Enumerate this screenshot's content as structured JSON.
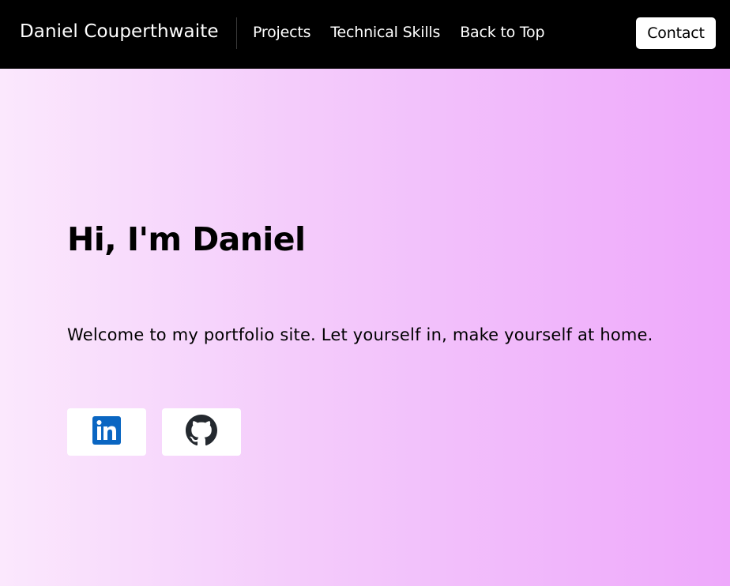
{
  "navbar": {
    "brand": "Daniel Couperthwaite",
    "links": [
      {
        "label": "Projects"
      },
      {
        "label": "Technical Skills"
      },
      {
        "label": "Back to Top"
      }
    ],
    "contact_label": "Contact"
  },
  "hero": {
    "title": "Hi, I'm Daniel",
    "text": "Welcome to my portfolio site. Let yourself in, make yourself at home.",
    "social": [
      {
        "icon": "linkedin-icon",
        "color": "#0a66c2"
      },
      {
        "icon": "github-icon",
        "color": "#24292f"
      }
    ]
  },
  "colors": {
    "navbar_bg": "#000000",
    "gradient_start": "#fbe8fd",
    "gradient_end": "#eea8fb"
  }
}
